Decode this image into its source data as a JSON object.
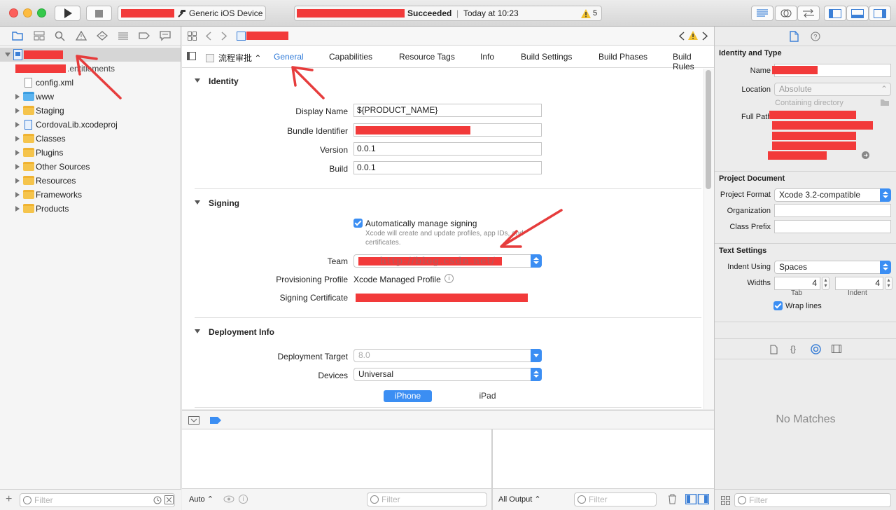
{
  "toolbar": {
    "scheme_device": "Generic iOS Device",
    "status_result": "Succeeded",
    "status_time": "Today at 10:23",
    "warning_count": "5"
  },
  "navigator": {
    "items": [
      {
        "label": "config.xml",
        "kind": "file"
      },
      {
        "label": "www",
        "kind": "folder-blue"
      },
      {
        "label": "Staging",
        "kind": "folder"
      },
      {
        "label": "CordovaLib.xcodeproj",
        "kind": "project"
      },
      {
        "label": "Classes",
        "kind": "folder"
      },
      {
        "label": "Plugins",
        "kind": "folder"
      },
      {
        "label": "Other Sources",
        "kind": "folder"
      },
      {
        "label": "Resources",
        "kind": "folder"
      },
      {
        "label": "Frameworks",
        "kind": "folder"
      },
      {
        "label": "Products",
        "kind": "folder"
      }
    ],
    "entitlements_suffix": ".entitlements",
    "filter_placeholder": "Filter"
  },
  "editor": {
    "target": "流程审批",
    "tabs": [
      "General",
      "Capabilities",
      "Resource Tags",
      "Info",
      "Build Settings",
      "Build Phases",
      "Build Rules"
    ],
    "identity": {
      "header": "Identity",
      "display_name_label": "Display Name",
      "display_name_value": "${PRODUCT_NAME}",
      "bundle_label": "Bundle Identifier",
      "version_label": "Version",
      "version_value": "0.0.1",
      "build_label": "Build",
      "build_value": "0.0.1"
    },
    "signing": {
      "header": "Signing",
      "auto_label": "Automatically manage signing",
      "auto_desc1": "Xcode will create and update profiles, app IDs, and",
      "auto_desc2": "certificates.",
      "team_label": "Team",
      "profile_label": "Provisioning Profile",
      "profile_value": "Xcode Managed Profile",
      "cert_label": "Signing Certificate",
      "watermark": "http://blog.csdn.net/"
    },
    "deployment": {
      "header": "Deployment Info",
      "target_label": "Deployment Target",
      "target_value": "8.0",
      "devices_label": "Devices",
      "devices_value": "Universal",
      "seg_iphone": "iPhone",
      "seg_ipad": "iPad"
    }
  },
  "debug": {
    "auto_label": "Auto",
    "output_label": "All Output",
    "filter_placeholder": "Filter"
  },
  "inspector": {
    "identity_header": "Identity and Type",
    "name_label": "Name",
    "location_label": "Location",
    "location_value": "Absolute",
    "containing": "Containing directory",
    "full_path_label": "Full Path",
    "project_doc_header": "Project Document",
    "project_format_label": "Project Format",
    "project_format_value": "Xcode 3.2-compatible",
    "organization_label": "Organization",
    "class_prefix_label": "Class Prefix",
    "text_settings_header": "Text Settings",
    "indent_using_label": "Indent Using",
    "indent_using_value": "Spaces",
    "widths_label": "Widths",
    "tab_value": "4",
    "indent_value": "4",
    "tab_label": "Tab",
    "indent_label": "Indent",
    "wrap_label": "Wrap lines",
    "no_matches": "No Matches",
    "filter_placeholder": "Filter"
  },
  "colors": {
    "accent": "#3b8ef3",
    "redaction": "#f23a3a"
  }
}
